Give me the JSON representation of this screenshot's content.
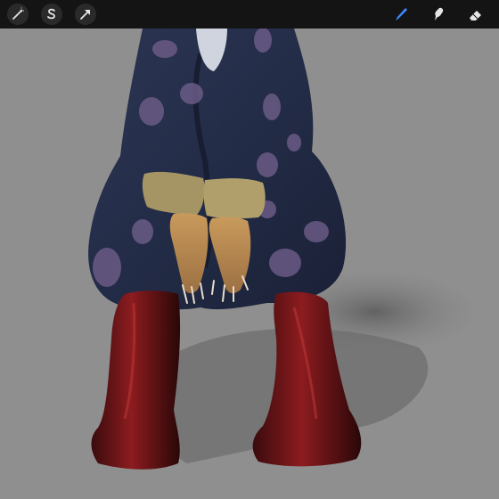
{
  "toolbar": {
    "left_tools": [
      {
        "name": "adjustments",
        "icon": "magic-wand-icon"
      },
      {
        "name": "selection",
        "icon": "selection-s-icon"
      },
      {
        "name": "transform",
        "icon": "arrow-cursor-icon"
      }
    ],
    "right_tools": [
      {
        "name": "brush",
        "icon": "brush-icon",
        "active": true
      },
      {
        "name": "smudge",
        "icon": "smudge-finger-icon",
        "active": false
      },
      {
        "name": "eraser",
        "icon": "eraser-icon",
        "active": false
      }
    ],
    "active_color": "#3a8dff"
  },
  "canvas": {
    "background_color": "#8f8f8f",
    "artwork_description_icon": "character-painting"
  }
}
